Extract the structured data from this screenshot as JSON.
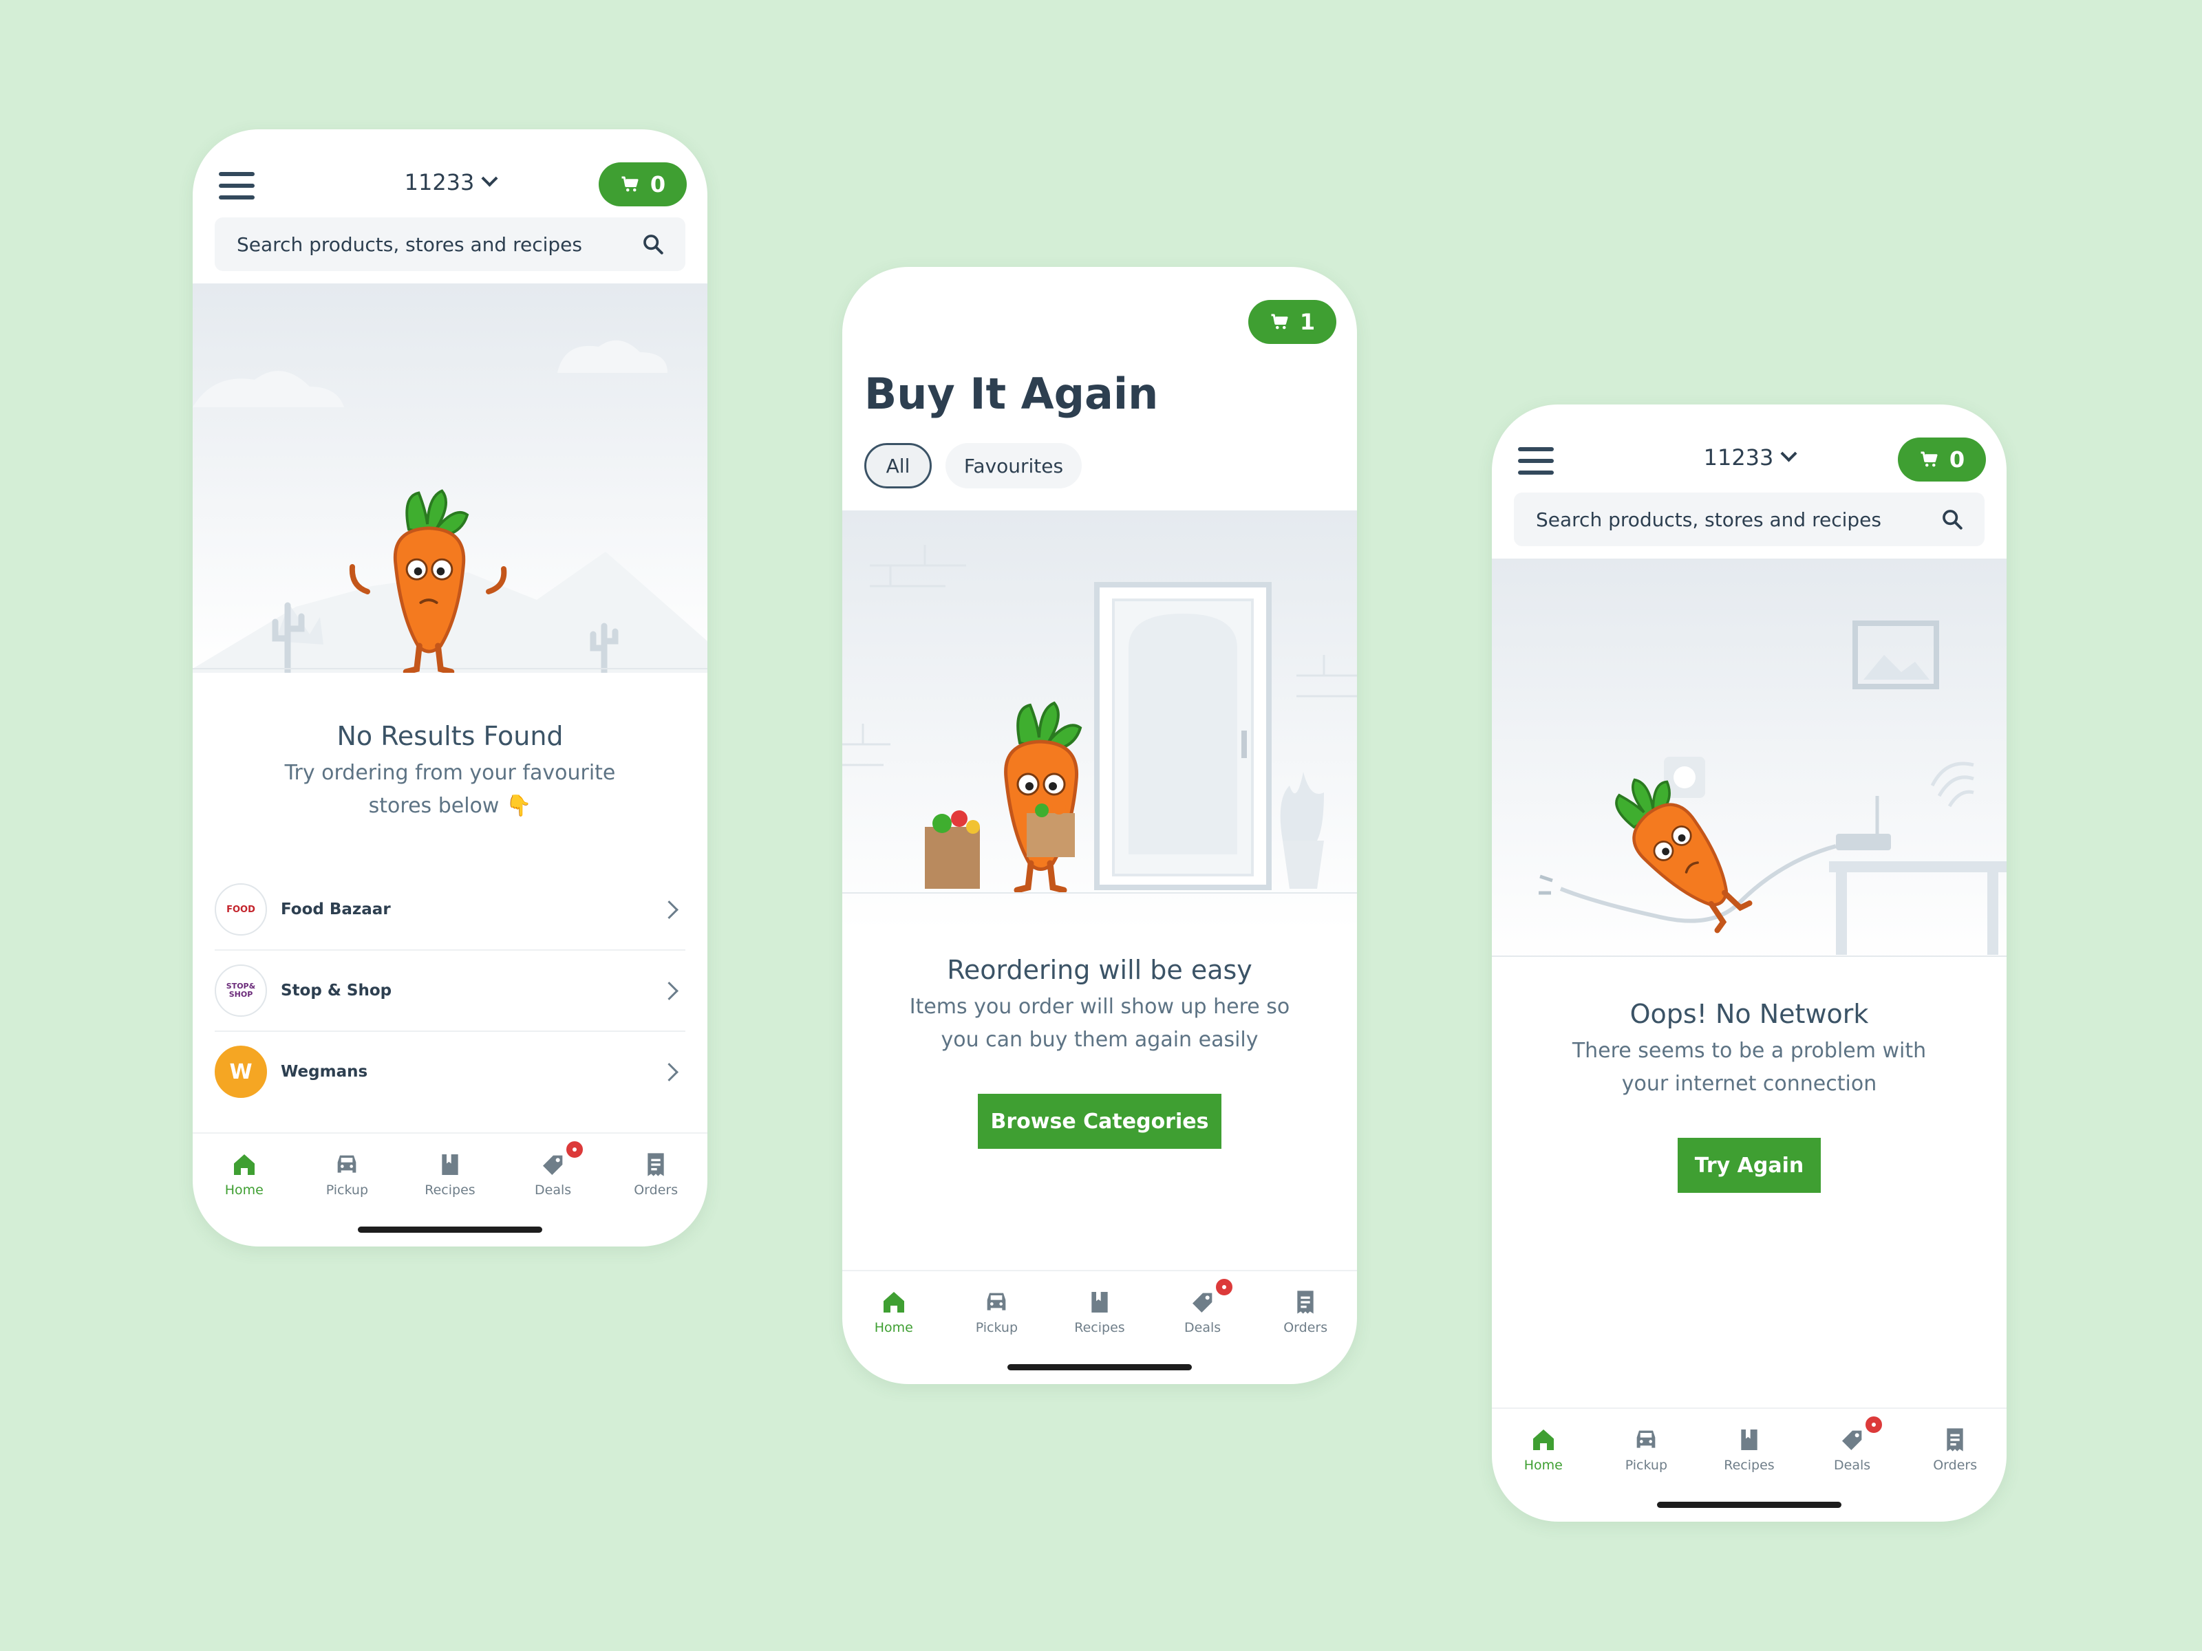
{
  "colors": {
    "background": "#d4eed6",
    "accent": "#3f9f32",
    "badge": "#dc3a3a",
    "text": "#2d3f50"
  },
  "tabs": [
    {
      "label": "Home",
      "icon": "home-icon"
    },
    {
      "label": "Pickup",
      "icon": "pickup-icon"
    },
    {
      "label": "Recipes",
      "icon": "recipes-icon"
    },
    {
      "label": "Deals",
      "icon": "deals-icon"
    },
    {
      "label": "Orders",
      "icon": "orders-icon"
    }
  ],
  "screen1": {
    "zip": "11233",
    "cart_count": "0",
    "search_placeholder": "Search products, stores and recipes",
    "title": "No Results Found",
    "subtitle": "Try ordering from your favourite stores below 👇",
    "stores": [
      {
        "name": "Food Bazaar",
        "logo_text": "FOOD"
      },
      {
        "name": "Stop & Shop",
        "logo_text": "STOP& SHOP"
      },
      {
        "name": "Wegmans",
        "logo_text": "W"
      }
    ]
  },
  "screen2": {
    "cart_count": "1",
    "title": "Buy It Again",
    "filters": [
      "All",
      "Favourites"
    ],
    "message_title": "Reordering will be easy",
    "message_subtitle": "Items you order will show up here so you can buy them again easily",
    "button": "Browse Categories"
  },
  "screen3": {
    "zip": "11233",
    "cart_count": "0",
    "search_placeholder": "Search products, stores and recipes",
    "message_title": "Oops! No Network",
    "message_subtitle": "There seems to be a problem with your internet connection",
    "button": "Try Again"
  }
}
